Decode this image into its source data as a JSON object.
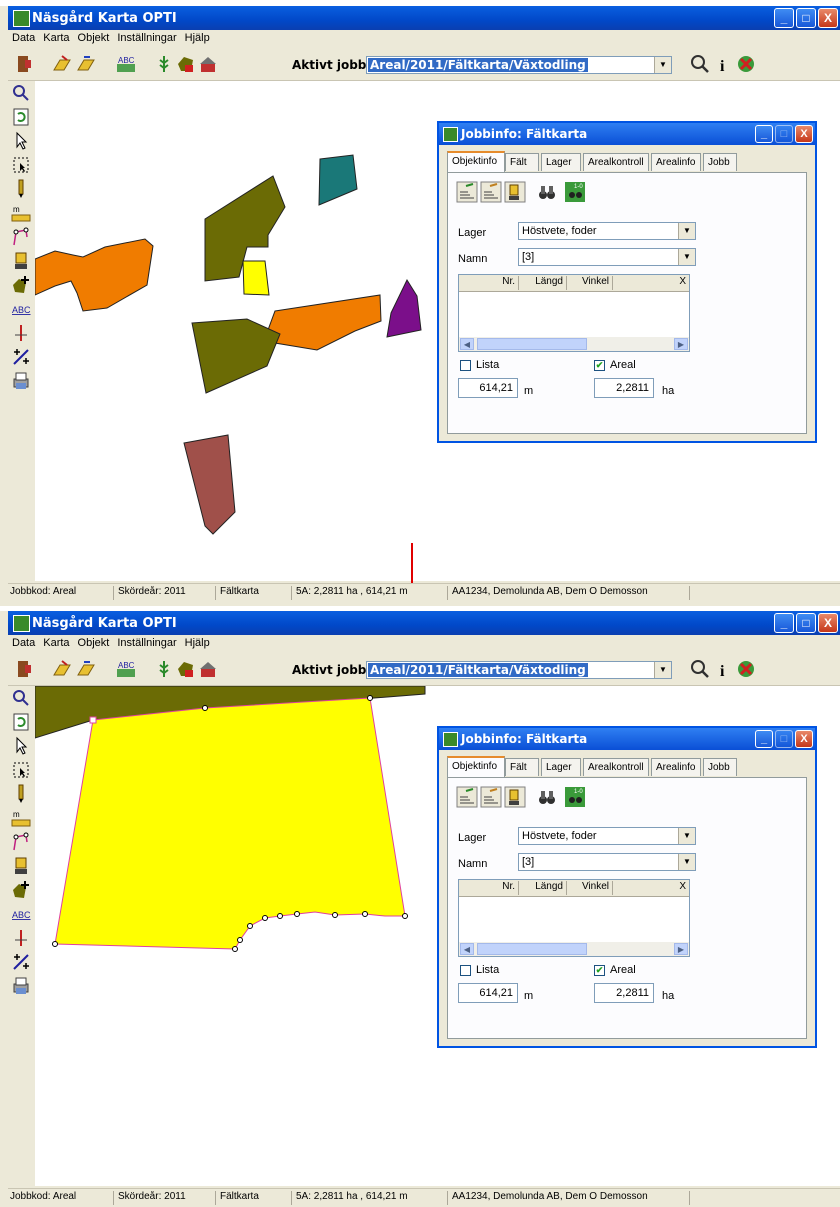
{
  "app": {
    "title": "Näsgård Karta OPTI",
    "window_buttons": {
      "minimize": "_",
      "maximize": "□",
      "close": "X"
    }
  },
  "menu": [
    "Data",
    "Karta",
    "Objekt",
    "Inställningar",
    "Hjälp"
  ],
  "toolbar": {
    "aktivt_jobb_label": "Aktivt jobb",
    "aktivt_jobb_value": "Areal/2011/Fältkarta/Växtodling",
    "icons": [
      "exit-icon",
      "open-map-icon",
      "close-map-icon",
      "abc-text-icon",
      "crop-icon",
      "layer-icon",
      "ha-area-icon",
      "farm-icon",
      "zoom-icon",
      "info-icon",
      "stop-icon"
    ]
  },
  "sidebar_icons": [
    "zoom-icon",
    "refresh-icon",
    "pointer-icon",
    "select-area-icon",
    "pen-icon",
    "measure-icon",
    "edit-nodes-icon",
    "gps-icon",
    "add-object-icon",
    "abc-label-icon",
    "marker-icon",
    "split-icon",
    "print-icon"
  ],
  "status": {
    "jobbkod": "Jobbkod: Areal",
    "skordear": "Skördeår: 2011",
    "faltkarta": "Fältkarta",
    "area": "5A: 2,2811 ha , 614,21 m",
    "farm": "AA1234, Demolunda AB, Dem O Demosson"
  },
  "jobbinfo": {
    "title": "Jobbinfo: Fältkarta",
    "tabs": [
      "Objektinfo",
      "Fält",
      "Lager",
      "Arealkontroll",
      "Arealinfo",
      "Jobb"
    ],
    "active_tab": "Objektinfo",
    "lager_label": "Lager",
    "lager_value": "Höstvete, foder",
    "namn_label": "Namn",
    "namn_value": "[3]",
    "grid_columns": [
      "Nr.",
      "Längd",
      "Vinkel"
    ],
    "grid_close": "X",
    "lista_label": "Lista",
    "lista_checked": false,
    "areal_label": "Areal",
    "areal_checked": true,
    "length_value": "614,21",
    "length_unit": "m",
    "area_value": "2,2811",
    "area_unit": "ha"
  },
  "colors": {
    "olive": "#6b6b05",
    "teal": "#1a7878",
    "orange": "#f07c00",
    "yellow": "#ffff00",
    "purple": "#7b0f8a",
    "brown": "#a0504a",
    "arrow": "#e00000",
    "titlebar": "#0a4fd6"
  }
}
